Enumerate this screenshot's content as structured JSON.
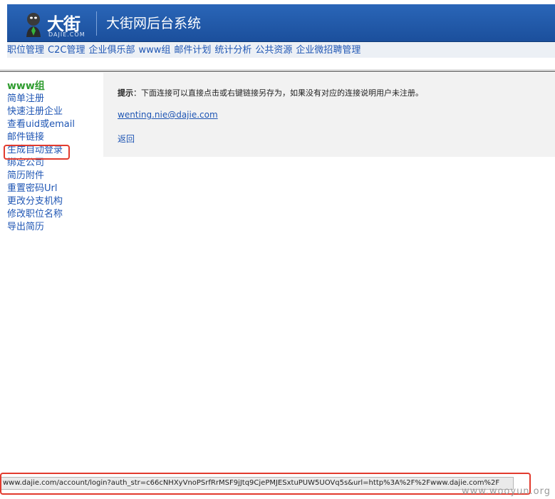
{
  "header": {
    "logo_text": "大街",
    "logo_sub": "DAJIE.COM",
    "system_title": "大街网后台系统"
  },
  "nav": {
    "items": [
      {
        "label": "职位管理"
      },
      {
        "label": "C2C管理"
      },
      {
        "label": "企业俱乐部"
      },
      {
        "label": "www组"
      },
      {
        "label": "邮件计划"
      },
      {
        "label": "统计分析"
      },
      {
        "label": "公共资源"
      },
      {
        "label": "企业微招聘管理"
      }
    ]
  },
  "sidebar": {
    "group_title": "www组",
    "items": [
      {
        "label": "简单注册"
      },
      {
        "label": "快速注册企业"
      },
      {
        "label": "查看uid或email"
      },
      {
        "label": "邮件链接"
      },
      {
        "label": "生成自动登录"
      },
      {
        "label": "绑定公司"
      },
      {
        "label": "简历附件"
      },
      {
        "label": "重置密码Url"
      },
      {
        "label": "更改分支机构"
      },
      {
        "label": "修改职位名称"
      },
      {
        "label": "导出简历"
      }
    ]
  },
  "content": {
    "tip_label": "提示",
    "tip_text": "：下面连接可以直接点击或右键链接另存为，如果没有对应的连接说明用户未注册。",
    "email": "wenting.nie@dajie.com",
    "back_label": "返回"
  },
  "statusbar": {
    "url": "www.dajie.com/account/login?auth_str=c66cNHXyVnoPSrfRrMSF9jJtq9CjePMJESxtuPUW5UOVq5s&url=http%3A%2F%2Fwww.dajie.com%2F"
  },
  "watermark": "www.wooyun.org",
  "colors": {
    "header_bg": "#1f58a8",
    "link": "#1f56b4",
    "group_title": "#2f9c2f",
    "highlight": "#e23b2e"
  }
}
